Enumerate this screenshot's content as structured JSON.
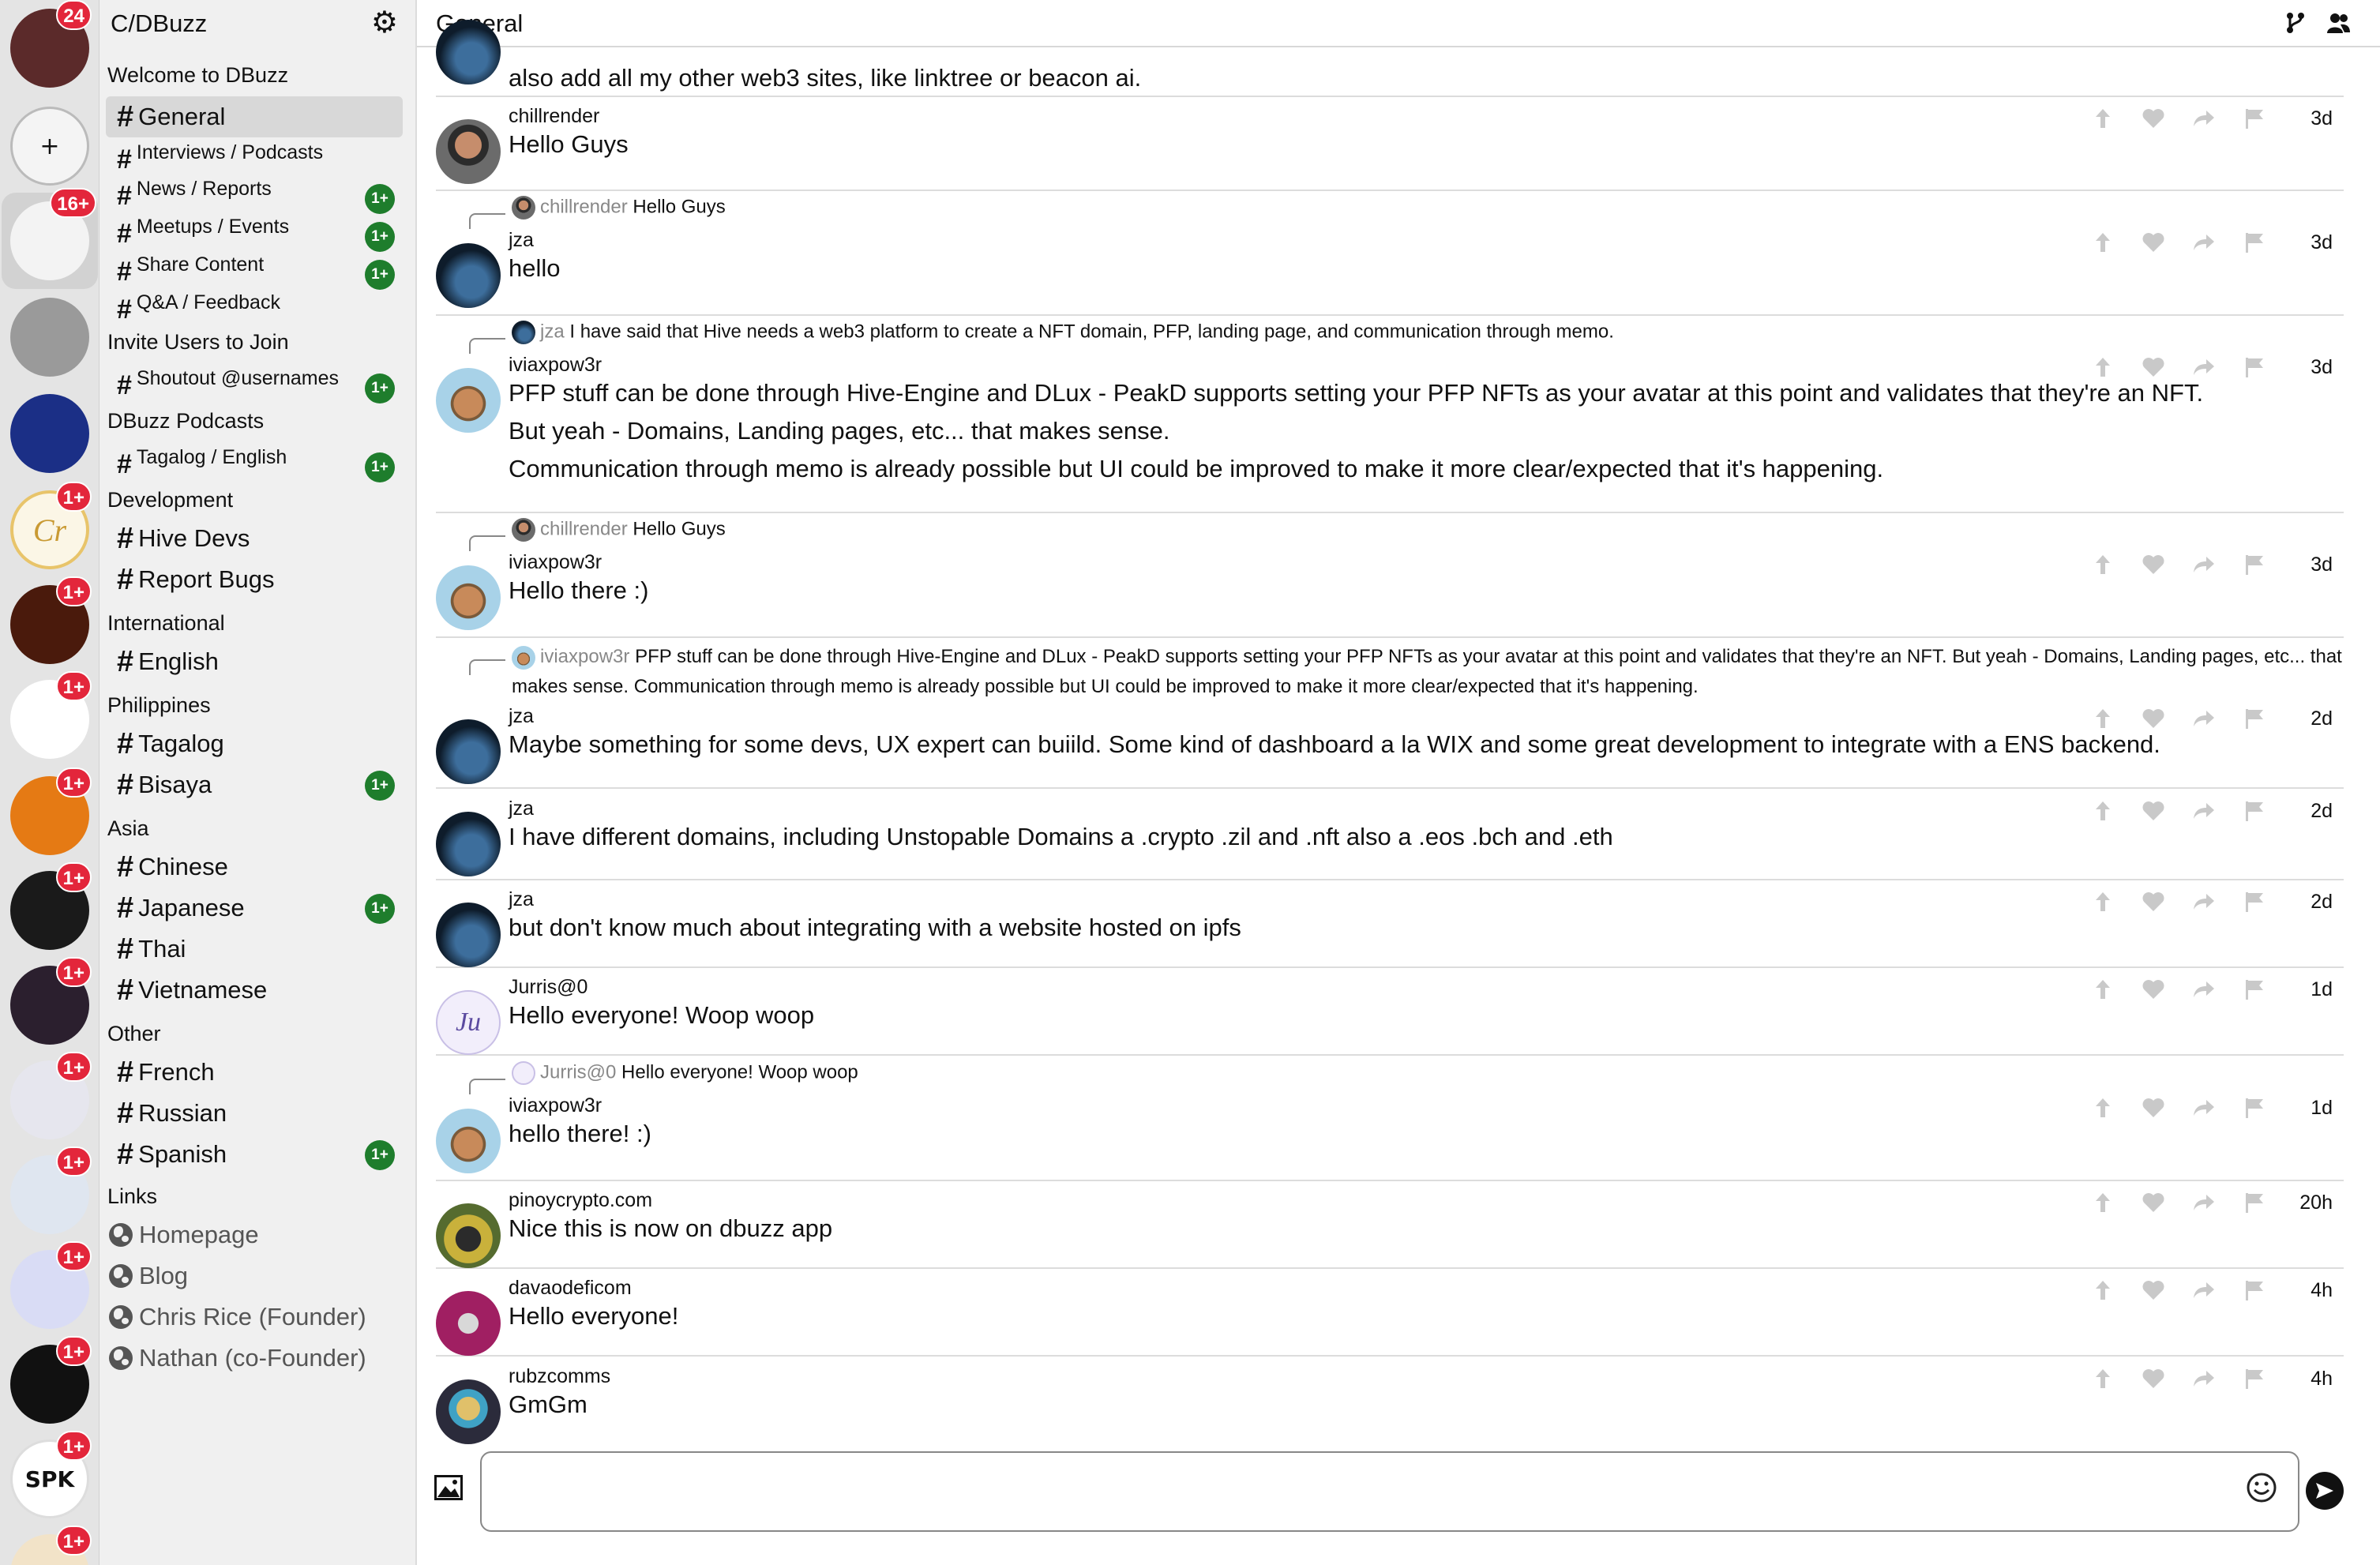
{
  "rail": {
    "items": [
      {
        "name": "rail-avatar-dbuzz",
        "badge": "24",
        "bg": "#5b2a2a",
        "letters": ""
      },
      {
        "name": "rail-add-community",
        "badge": "",
        "bg": "#f4f4f4",
        "letters": "+"
      },
      {
        "name": "rail-avatar-red-logo",
        "badge": "16+",
        "bg": "#f3f3f3",
        "letters": ""
      },
      {
        "name": "rail-avatar-default-user",
        "badge": "",
        "bg": "#9a9a9a",
        "letters": ""
      },
      {
        "name": "rail-avatar-sun",
        "badge": "",
        "bg": "#1b2f86",
        "letters": ""
      },
      {
        "name": "rail-avatar-cr",
        "badge": "1+",
        "bg": "#fbf6e6",
        "letters": "Cr"
      },
      {
        "name": "rail-avatar-lion",
        "badge": "1+",
        "bg": "#4a1a0c",
        "letters": ""
      },
      {
        "name": "rail-avatar-runner",
        "badge": "1+",
        "bg": "#ffffff",
        "letters": ""
      },
      {
        "name": "rail-avatar-hive-orange",
        "badge": "1+",
        "bg": "#e57a14",
        "letters": ""
      },
      {
        "name": "rail-avatar-hive-gold",
        "badge": "1+",
        "bg": "#1a1a1a",
        "letters": ""
      },
      {
        "name": "rail-avatar-hive-pink",
        "badge": "1+",
        "bg": "#2b1f2e",
        "letters": ""
      },
      {
        "name": "rail-avatar-3s",
        "badge": "1+",
        "bg": "#e6e6ee",
        "letters": ""
      },
      {
        "name": "rail-avatar-husky",
        "badge": "1+",
        "bg": "#dfe6f0",
        "letters": ""
      },
      {
        "name": "rail-avatar-purple-slash",
        "badge": "1+",
        "bg": "#d9dcf5",
        "letters": ""
      },
      {
        "name": "rail-avatar-diver",
        "badge": "1+",
        "bg": "#111111",
        "letters": ""
      },
      {
        "name": "rail-avatar-spk",
        "badge": "1+",
        "bg": "#ffffff",
        "letters": "SPK"
      },
      {
        "name": "rail-avatar-last",
        "badge": "1+",
        "bg": "#f2e3c8",
        "letters": ""
      }
    ]
  },
  "sidebar": {
    "title": "C/DBuzz",
    "welcome": "Welcome to DBuzz",
    "ch_general": "General",
    "ch_interviews": "Interviews / Podcasts",
    "ch_news": "News / Reports",
    "ch_meetups": "Meetups / Events",
    "ch_share": "Share Content",
    "ch_qa": "Q&A / Feedback",
    "invite": "Invite Users to Join",
    "ch_shoutout": "Shoutout @usernames",
    "podcasts": "DBuzz Podcasts",
    "ch_tagalog_en": "Tagalog / English",
    "development": "Development",
    "ch_hivedevs": "Hive Devs",
    "ch_bugs": "Report Bugs",
    "international": "International",
    "ch_english": "English",
    "philippines": "Philippines",
    "ch_tagalog": "Tagalog",
    "ch_bisaya": "Bisaya",
    "asia": "Asia",
    "ch_chinese": "Chinese",
    "ch_japanese": "Japanese",
    "ch_thai": "Thai",
    "ch_vietnamese": "Vietnamese",
    "other": "Other",
    "ch_french": "French",
    "ch_russian": "Russian",
    "ch_spanish": "Spanish",
    "links": "Links",
    "link_homepage": "Homepage",
    "link_blog": "Blog",
    "link_chris": "Chris Rice (Founder)",
    "link_nathan": "Nathan (co-Founder)",
    "new_badge": "1+"
  },
  "header": {
    "title": "General"
  },
  "messages": {
    "m0": {
      "text": "also add all my other web3 sites, like linktree or beacon ai."
    },
    "m1": {
      "user": "chillrender",
      "text": "Hello Guys",
      "time": "3d"
    },
    "m2": {
      "reply_user": "chillrender",
      "reply_text": "Hello Guys",
      "user": "jza",
      "text": "hello",
      "time": "3d"
    },
    "m3": {
      "reply_user": "jza",
      "reply_text": "I have said that Hive needs a web3 platform to create a NFT domain, PFP, landing page, and communication through memo.",
      "user": "iviaxpow3r",
      "line1": "PFP stuff can be done through Hive-Engine and DLux - PeakD supports setting your PFP NFTs as your avatar at this point and validates that they're an NFT.",
      "line2": "But yeah - Domains, Landing pages, etc... that makes sense.",
      "line3": "Communication through memo is already possible but UI could be improved to make it more clear/expected that it's happening.",
      "time": "3d"
    },
    "m4": {
      "reply_user": "chillrender",
      "reply_text": "Hello Guys",
      "user": "iviaxpow3r",
      "text": "Hello there :)",
      "time": "3d"
    },
    "m5": {
      "reply_user": "iviaxpow3r",
      "reply_text": "PFP stuff can be done through Hive-Engine and DLux - PeakD supports setting your PFP NFTs as your avatar at this point and validates that they're an NFT. But yeah - Domains, Landing pages, etc... that makes sense. Communication through memo is already possible but UI could be improved to make it more clear/expected that it's happening.",
      "user": "jza",
      "text": "Maybe something for some devs, UX expert can buiild. Some kind of dashboard a la WIX and some great development to integrate with a ENS backend.",
      "time": "2d"
    },
    "m6": {
      "user": "jza",
      "text": "I have different domains, including Unstopable Domains a .crypto .zil and .nft also a .eos .bch and .eth",
      "time": "2d"
    },
    "m7": {
      "user": "jza",
      "text": "but don't know much about integrating with a website hosted on ipfs",
      "time": "2d"
    },
    "m8": {
      "user": "Jurris@0",
      "avatar_letters": "Ju",
      "text": "Hello everyone! Woop woop",
      "time": "1d"
    },
    "m9": {
      "reply_user": "Jurris@0",
      "reply_text": "Hello everyone! Woop woop",
      "user": "iviaxpow3r",
      "text": "hello there! :)",
      "time": "1d"
    },
    "m10": {
      "user": "pinoycrypto.com",
      "text": "Nice this is now on dbuzz app",
      "time": "20h"
    },
    "m11": {
      "user": "davaodeficom",
      "text": "Hello everyone!",
      "time": "4h"
    },
    "m12": {
      "user": "rubzcomms",
      "text": "GmGm",
      "time": "4h"
    }
  },
  "composer": {
    "value": "",
    "placeholder": ""
  },
  "colors": {
    "badge_red": "#e3263b",
    "new_green": "#1e7d2c",
    "sidebar_bg": "#f0f0f0",
    "rail_bg": "#e4e4e4"
  }
}
